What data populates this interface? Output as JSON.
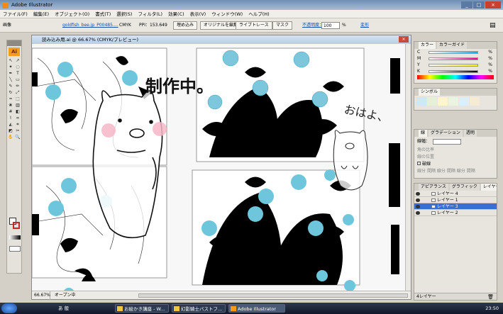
{
  "app": {
    "title": "Adobe Illustrator",
    "window_controls": [
      "_",
      "□",
      "×"
    ]
  },
  "menu": [
    "ファイル(F)",
    "編集(E)",
    "オブジェクト(O)",
    "書式(T)",
    "選択(S)",
    "フィルタ(L)",
    "効果(C)",
    "表示(V)",
    "ウィンドウ(W)",
    "ヘルプ(H)"
  ],
  "control_bar": {
    "mode": "画像",
    "filename": "goldfish_bee.jp_P00485....",
    "colormode": "CMYK",
    "ppi": "PPI：153.649",
    "embed_btn": "埋め込み",
    "edit_original_btn": "オリジナルを編集",
    "livetrace_btn": "ライブトレース",
    "mask_btn": "マスク",
    "opacity_label": "不透明度：",
    "opacity_value": "100",
    "opacity_unit": "%",
    "transform_label": "変形"
  },
  "document": {
    "title": "読み込み用.ai @ 66.67% (CMYK/プレビュー)",
    "zoom": "66.67%",
    "status": "オープン中",
    "handwriting": [
      "制作中。",
      "おはよ、"
    ]
  },
  "colors": {
    "accent": "#f29b1d",
    "selected": "#3a6ed0",
    "circle": "#6ec6dd"
  },
  "color_panel": {
    "tabs": [
      "カラー",
      "カラーガイド"
    ],
    "channels": [
      {
        "label": "C",
        "unit": "%"
      },
      {
        "label": "M",
        "unit": "%"
      },
      {
        "label": "Y",
        "unit": "%"
      },
      {
        "label": "K",
        "unit": "%"
      }
    ]
  },
  "symbol_panel": {
    "tabs": [
      "シンボル"
    ]
  },
  "stroke_panel": {
    "tabs": [
      "線",
      "グラデーション",
      "透明"
    ],
    "weight_label": "線幅：",
    "rows": [
      "角の比率",
      "線の位置"
    ],
    "dash_label": "破線",
    "dash_fields": [
      "線分",
      "間隔",
      "線分",
      "間隔",
      "線分",
      "間隔"
    ]
  },
  "layers_panel": {
    "tabs": [
      "アピアランス",
      "グラフィック",
      "レイヤー"
    ],
    "layers": [
      {
        "name": "レイヤー 4",
        "selected": false
      },
      {
        "name": "レイヤー 1",
        "selected": false
      },
      {
        "name": "レイヤー 3",
        "selected": true
      },
      {
        "name": "レイヤー 2",
        "selected": false
      }
    ],
    "footer": "4レイヤー"
  },
  "taskbar": {
    "ime": "あ 般",
    "tasks": [
      {
        "label": "お絵かき講座 - W...",
        "active": false
      },
      {
        "label": "幻影騎士バストフ...",
        "active": false
      },
      {
        "label": "Adobe Illustrator",
        "active": true
      }
    ],
    "clock": "23:50"
  }
}
